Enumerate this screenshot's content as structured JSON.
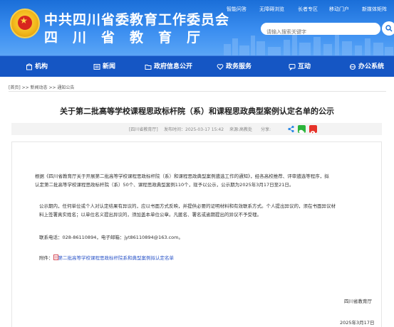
{
  "header": {
    "title_cn": "中共四川省委教育工作委员会",
    "title_dept": "四川省教育厅",
    "top_links": [
      "智能问答",
      "无障碍浏览",
      "长者专区",
      "移动门户",
      "新媒体矩阵"
    ],
    "search_placeholder": "请输入搜索关键字"
  },
  "nav": {
    "items": [
      {
        "label": "机构",
        "icon": "building-icon"
      },
      {
        "label": "新闻",
        "icon": "newspaper-icon"
      },
      {
        "label": "政府信息公开",
        "icon": "folder-icon"
      },
      {
        "label": "政务服务",
        "icon": "heart-hand-icon"
      },
      {
        "label": "互动",
        "icon": "chat-icon"
      },
      {
        "label": "办公系统",
        "icon": "system-icon"
      }
    ]
  },
  "breadcrumb": "[首页] >> 新闻动态 >> 通知公告",
  "article": {
    "title": "关于第二批高等学校课程思政标杆院（系）和课程思政典型案例认定名单的公示",
    "meta": {
      "source": "[四川省教育厅]",
      "publish_time": "发布时间：2025-03-17 15:42",
      "author": "来源:高教处",
      "share_label": "分享:"
    },
    "paragraph1_line1": "根据《四川省教育厅关于开展第二批高等学校课程思政标杆院（系）和课程思政典型案例遴选工作的通知》，经各高校推荐、评审遴选等程序，拟",
    "paragraph1_line2": "认定第二批高等学校课程思政标杆院（系）50个、课程思政典型案例110个，现予以公示，公示期为2025年3月17日至21日。",
    "paragraph2_line1": "公示期内，任何单位或个人对认定结果有异议的，应以书面方式反映，并提供必要的证明材料和有效联系方式。个人提出异议的，须在书面异议材",
    "paragraph2_line2": "料上签署真实姓名；以单位名义提出异议的，须加盖本单位公章。凡匿名、署名或逾期提出的异议不予受理。",
    "contact": "联系电话：028-86110894，电子邮箱：jyt86110894@163.com。",
    "attachment_label": "附件：",
    "attachment_link": "第二批高等学校课程思政标杆院系和典型案例拟认定名单",
    "signature": "四川省教育厅",
    "date": "2025年3月17日"
  },
  "colors": {
    "header_blue": "#1a6ed8",
    "nav_blue": "#1556c4",
    "link_blue": "#2a54c8",
    "wechat_green": "#2bb43a",
    "weibo_red": "#e6332a"
  }
}
